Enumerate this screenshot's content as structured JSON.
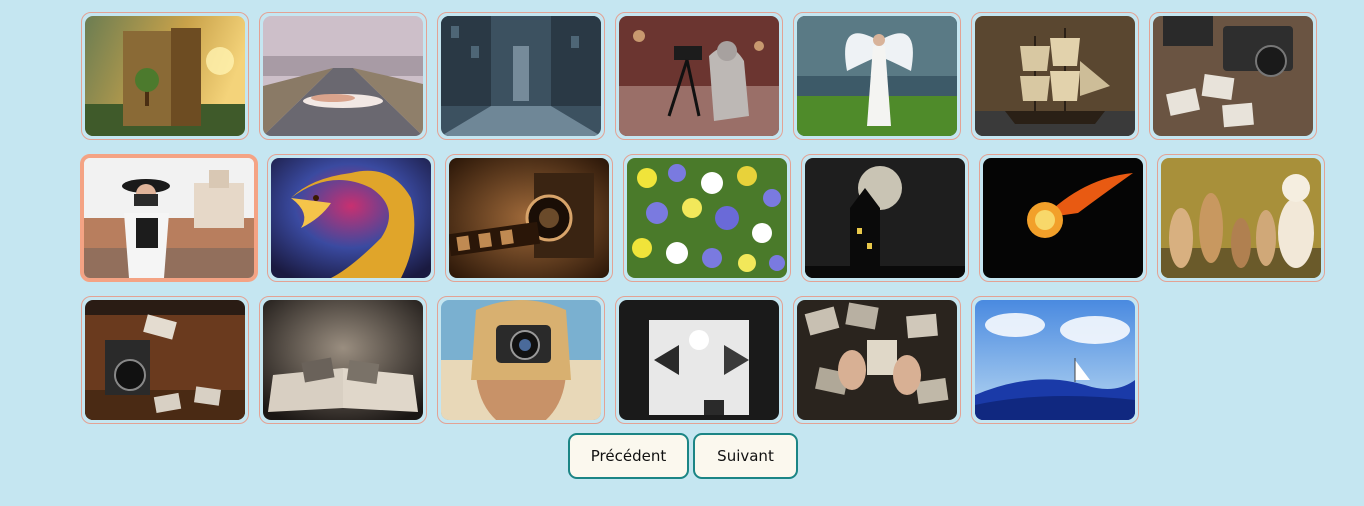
{
  "gallery": {
    "images": [
      {
        "name": "open-book-landscape"
      },
      {
        "name": "road-swimmer"
      },
      {
        "name": "stormy-city-street"
      },
      {
        "name": "photographer-tripod"
      },
      {
        "name": "angel-woman"
      },
      {
        "name": "sailing-ship"
      },
      {
        "name": "vintage-cameras-photos"
      },
      {
        "name": "woman-camera-rooftops",
        "selected": true
      },
      {
        "name": "golden-dragon"
      },
      {
        "name": "old-camera-film"
      },
      {
        "name": "flower-field"
      },
      {
        "name": "haunted-house-moon"
      },
      {
        "name": "flaming-football"
      },
      {
        "name": "puppies-and-kittens"
      },
      {
        "name": "camera-on-suitcase"
      },
      {
        "name": "book-of-photos"
      },
      {
        "name": "woman-holding-camera"
      },
      {
        "name": "photo-studio"
      },
      {
        "name": "hands-old-photos"
      },
      {
        "name": "boat-in-sky-wave"
      }
    ]
  },
  "pagination": {
    "prev_label": "Précédent",
    "next_label": "Suivant"
  },
  "colors": {
    "background": "#c5e6f1",
    "thumb_border": "#e3a294",
    "selected_border": "#f4a384",
    "button_border": "#1b8585",
    "button_bg": "#fbf8ee"
  }
}
